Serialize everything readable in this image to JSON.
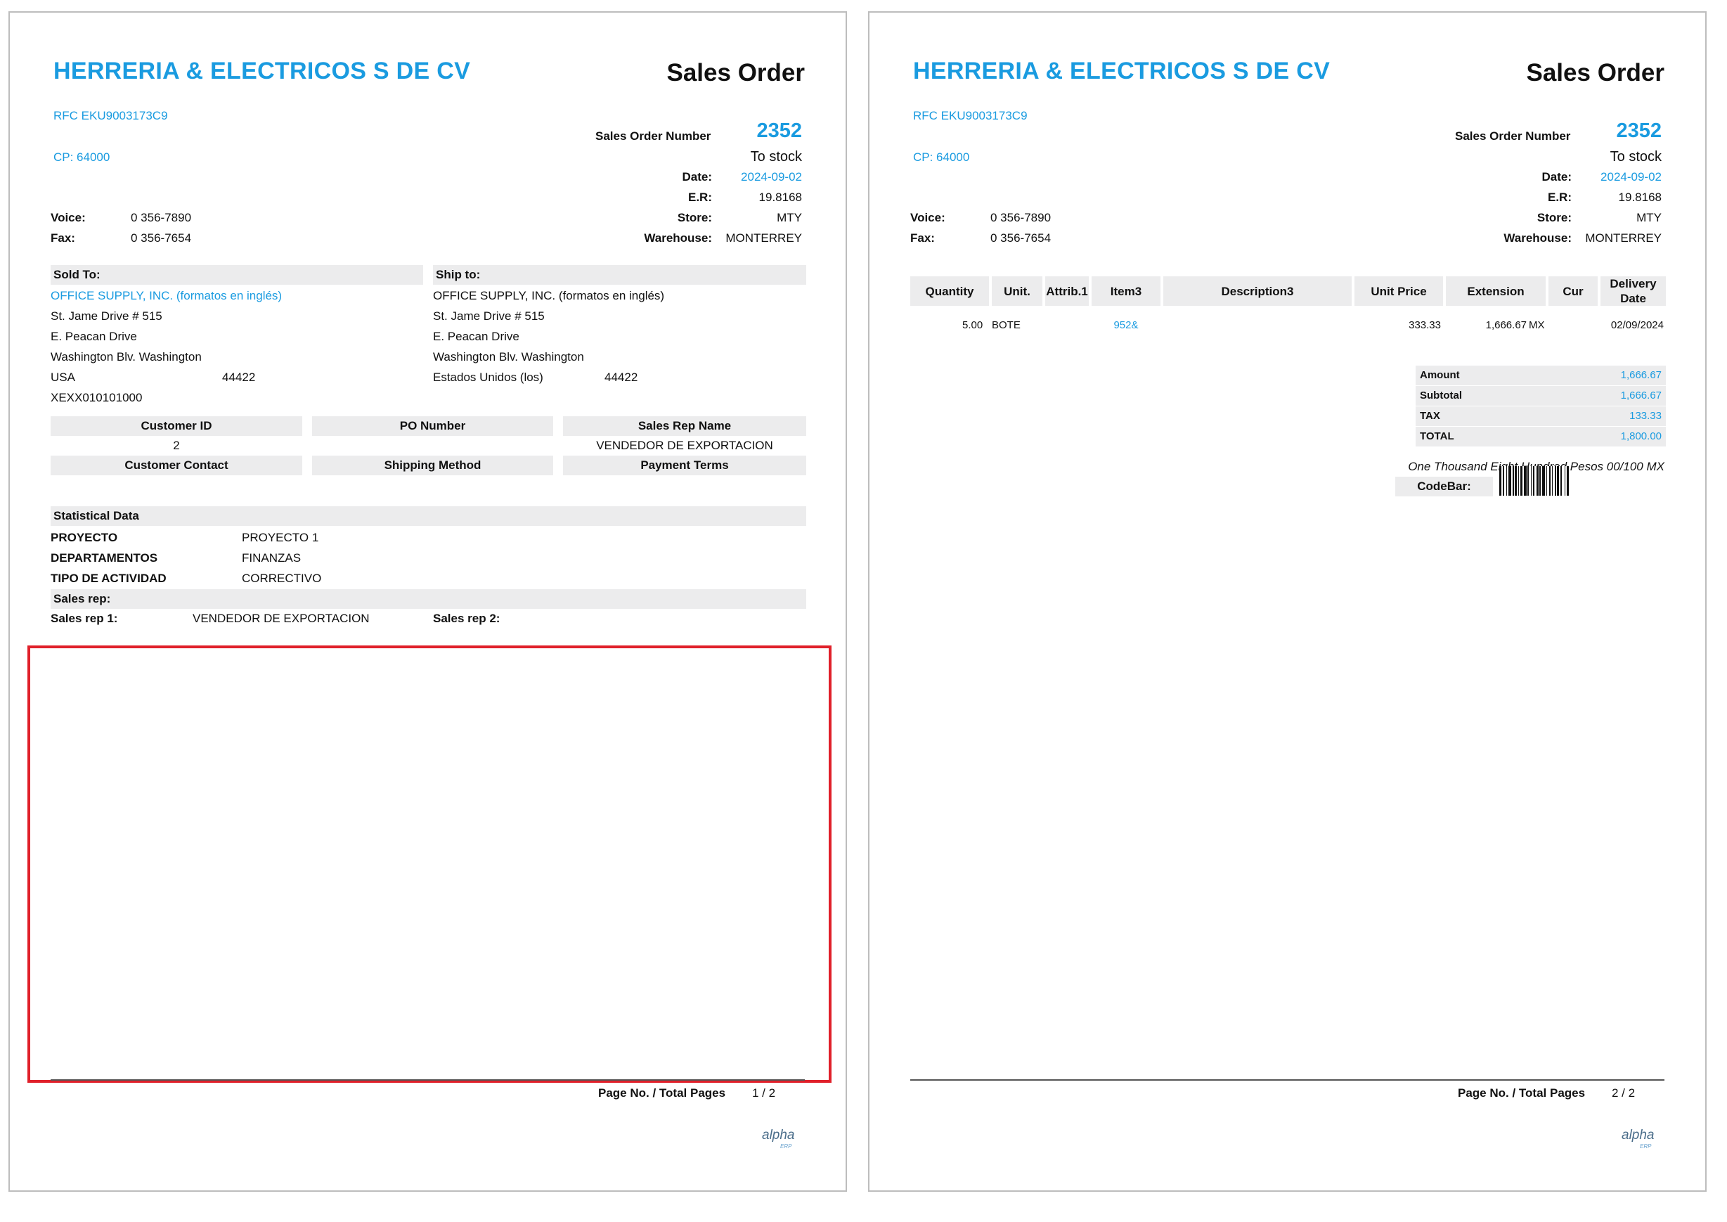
{
  "company": {
    "name": "HERRERIA & ELECTRICOS S DE CV",
    "rfc": "RFC EKU9003173C9",
    "cp": "CP: 64000"
  },
  "doc_title": "Sales Order",
  "order": {
    "number_label": "Sales Order Number",
    "number": "2352",
    "type": "To stock",
    "date_label": "Date:",
    "date": "2024-09-02",
    "er_label": "E.R:",
    "er": "19.8168",
    "store_label": "Store:",
    "store": "MTY",
    "warehouse_label": "Warehouse:",
    "warehouse": "MONTERREY"
  },
  "contact": {
    "voice_label": "Voice:",
    "voice": "0 356-7890",
    "fax_label": "Fax:",
    "fax": "0 356-7654"
  },
  "sold_to": {
    "header": "Sold To:",
    "name": "OFFICE SUPPLY, INC. (formatos en inglés)",
    "street": "St. Jame Drive  # 515",
    "line2": "E. Peacan Drive",
    "city": "Washington Blv. Washington",
    "country": "USA",
    "zip": "44422",
    "tax_id": "XEXX010101000"
  },
  "ship_to": {
    "header": "Ship to:",
    "name": "OFFICE SUPPLY, INC. (formatos en inglés)",
    "street": "St. Jame Drive  # 515",
    "line2": "E. Peacan Drive",
    "city": "Washington Blv. Washington",
    "country": "Estados Unidos (los)",
    "zip": "44422"
  },
  "info_grid": {
    "customer_id_label": "Customer ID",
    "customer_id": "2",
    "po_number_label": "PO Number",
    "po_number": "",
    "sales_rep_name_label": "Sales Rep Name",
    "sales_rep_name": "VENDEDOR DE EXPORTACION",
    "customer_contact_label": "Customer Contact",
    "shipping_method_label": "Shipping Method",
    "payment_terms_label": "Payment Terms"
  },
  "statistical": {
    "header": "Statistical Data",
    "rows": [
      {
        "k": "PROYECTO",
        "v": "PROYECTO 1"
      },
      {
        "k": "DEPARTAMENTOS",
        "v": "FINANZAS"
      },
      {
        "k": "TIPO DE ACTIVIDAD",
        "v": "CORRECTIVO"
      }
    ]
  },
  "sales_rep": {
    "header": "Sales rep:",
    "rep1_label": "Sales rep 1:",
    "rep1": "VENDEDOR DE EXPORTACION",
    "rep2_label": "Sales rep 2:"
  },
  "footer": {
    "page_label": "Page No. / Total Pages",
    "page1": "1 / 2",
    "page2": "2 / 2",
    "logo": "alpha",
    "logo_sub": "ERP"
  },
  "items_table": {
    "headers": {
      "quantity": "Quantity",
      "unit": "Unit.",
      "attrib": "Attrib.1",
      "item": "Item3",
      "description": "Description3",
      "unit_price": "Unit Price",
      "extension": "Extension",
      "cur": "Cur",
      "delivery": "Delivery\nDate"
    },
    "rows": [
      {
        "quantity": "5.00",
        "unit": "BOTE",
        "attrib": "",
        "item": "952&",
        "description": "",
        "unit_price": "333.33",
        "extension": "1,666.67",
        "cur": "MX",
        "delivery": "02/09/2024"
      }
    ]
  },
  "totals": {
    "amount_label": "Amount",
    "amount": "1,666.67",
    "subtotal_label": "Subtotal",
    "subtotal": "1,666.67",
    "tax_label": "TAX",
    "tax": "133.33",
    "total_label": "TOTAL",
    "total": "1,800.00",
    "in_words": "One Thousand Eight Hundred  Pesos 00/100 MX",
    "codebar_label": "CodeBar:"
  },
  "colors": {
    "accent": "#1a9be0",
    "header_bg": "#ececed",
    "highlight": "#e0202a"
  }
}
